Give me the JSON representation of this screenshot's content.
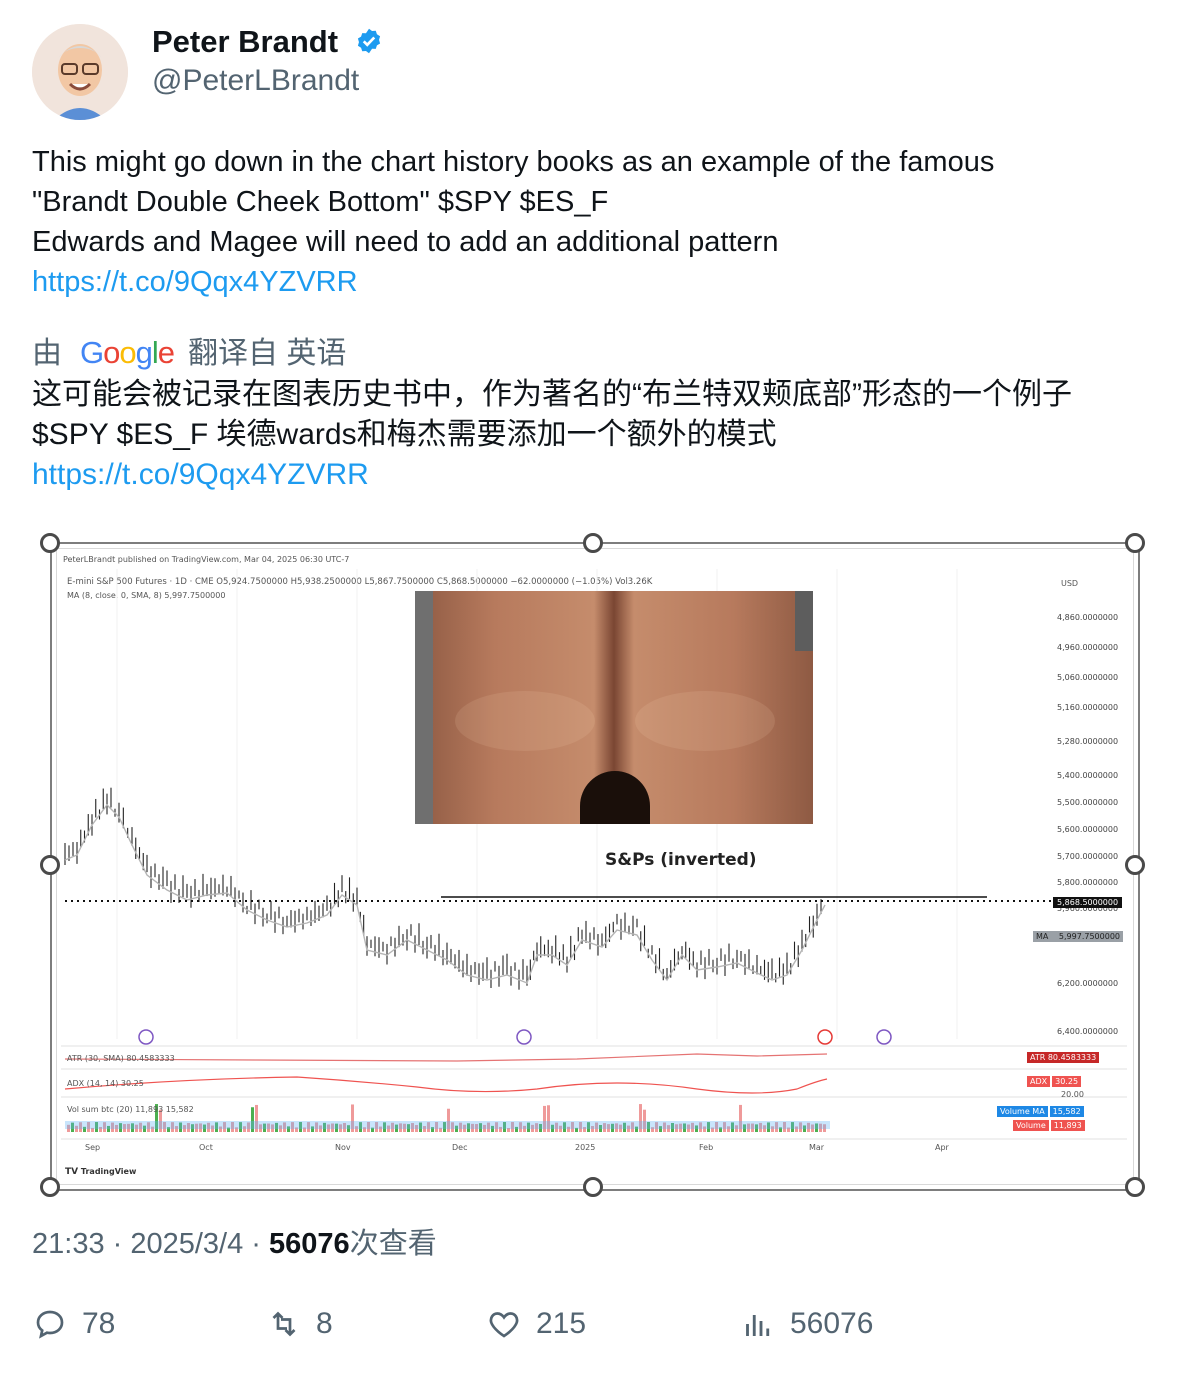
{
  "author": {
    "name": "Peter Brandt",
    "handle": "@PeterLBrandt",
    "verified": true,
    "badge_color": "#1d9bf0"
  },
  "tweet": {
    "line1": "This might go down in the chart history books as an example of the famous",
    "line2": "\"Brandt Double Cheek Bottom\" $SPY $ES_F",
    "line3": "Edwards and Magee will need to add an additional pattern",
    "link": "https://t.co/9Qqx4YZVRR"
  },
  "translation": {
    "by": "由",
    "provider": "Google",
    "from": "翻译自 英语",
    "line1": "这可能会被记录在图表历史书中，作为著名的“布兰特双颊底部”形态的一个例子",
    "line2": "$SPY $ES_F 埃德wards和梅杰需要添加一个额外的模式",
    "link": "https://t.co/9Qqx4YZVRR"
  },
  "chart": {
    "published": "PeterLBrandt published on TradingView.com, Mar 04, 2025 06:30 UTC-7",
    "symbol_line": "E-mini S&P 500 Futures · 1D · CME  O5,924.7500000  H5,938.2500000  L5,867.7500000  C5,868.5000000  −62.0000000 (−1.05%)  Vol3.26K",
    "ma_line": "MA (8, close, 0, SMA, 8)  5,997.7500000",
    "currency": "USD",
    "annotation": "S&Ps (inverted)",
    "price_axis": [
      "4,860.0000000",
      "4,960.0000000",
      "5,060.0000000",
      "5,160.0000000",
      "5,280.0000000",
      "5,400.0000000",
      "5,500.0000000",
      "5,600.0000000",
      "5,700.0000000",
      "5,800.0000000",
      "5,960.0000000",
      "6,200.0000000",
      "6,400.0000000"
    ],
    "last_price": "5,868.5000000",
    "ma_value": "5,997.7500000",
    "atr_label": "ATR (30, SMA)  80.4583333",
    "atr_value": "80.4583333",
    "adx_label": "ADX (14, 14)  30.25",
    "adx_value": "30.25",
    "adx_level": "20.00",
    "vol_label": "Vol sum btc (20)  11,893  15,582",
    "vol_ma": "15,582",
    "vol": "11,893",
    "tag_atr": "ATR",
    "tag_adx": "ADX",
    "tag_ma": "MA",
    "tag_volma": "Volume MA",
    "tag_vol": "Volume",
    "months": [
      "Sep",
      "Oct",
      "Nov",
      "Dec",
      "2025",
      "Feb",
      "Mar",
      "Apr"
    ],
    "logo": "TradingView"
  },
  "meta": {
    "time": "21:33",
    "date": "2025/3/4",
    "views": "56076",
    "views_suffix": "次查看"
  },
  "actions": {
    "replies": "78",
    "reposts": "8",
    "likes": "215",
    "views": "56076"
  }
}
